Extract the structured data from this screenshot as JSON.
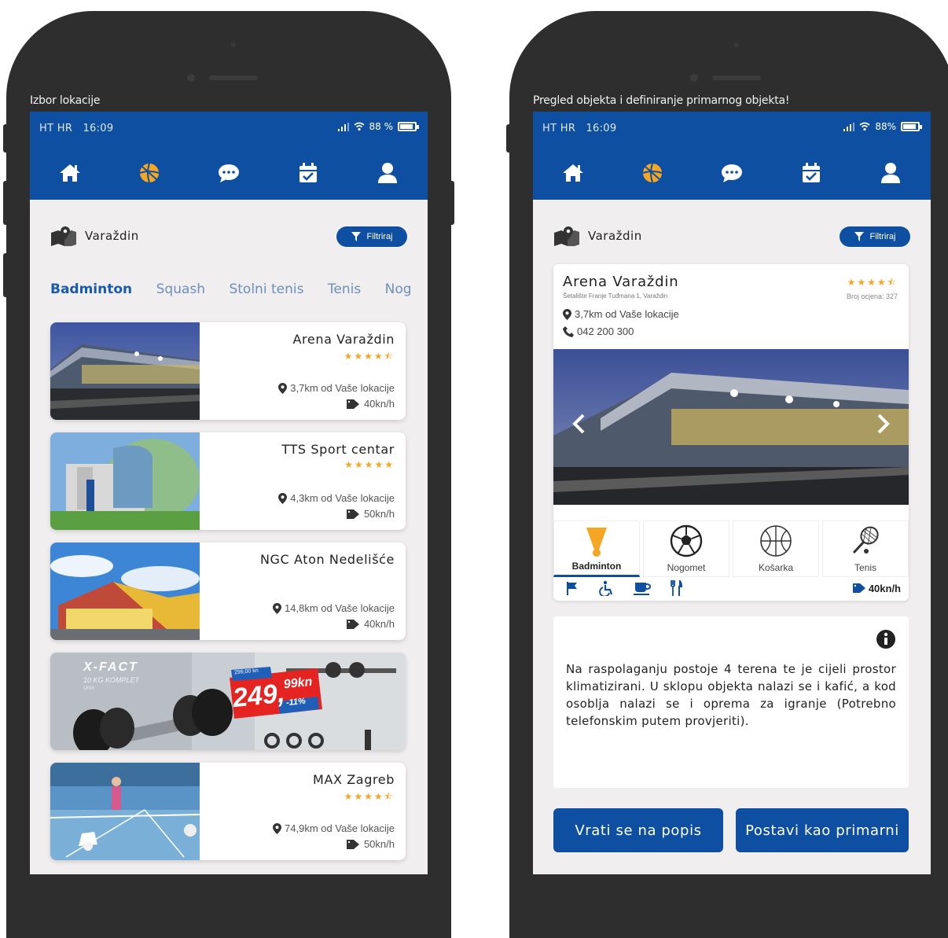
{
  "colors": {
    "brand": "#0e4fa2",
    "star": "#f5a623",
    "frame": "#2e2e2e",
    "screen_bg": "#f0eeee"
  },
  "left": {
    "caption": "Izbor lokacije",
    "status": {
      "carrier": "HT HR",
      "time": "16:09",
      "battery": "88 %",
      "battery_level": 0.88
    },
    "nav": [
      "home-icon",
      "volleyball-icon",
      "chat-icon",
      "calendar-check-icon",
      "user-icon"
    ],
    "location": "Varaždin",
    "filter_label": "Filtriraj",
    "tabs": [
      "Badminton",
      "Squash",
      "Stolni tenis",
      "Tenis",
      "Nog"
    ],
    "cards": [
      {
        "name": "Arena Varaždin",
        "stars": "★★★★⯪",
        "distance": "3,7km od Vaše lokacije",
        "price": "40kn/h"
      },
      {
        "name": "TTS Sport centar",
        "stars": "★★★★★",
        "distance": "4,3km od Vaše lokacije",
        "price": "50kn/h"
      },
      {
        "name": "NGC Aton Nedelišće",
        "stars": "",
        "distance": "14,8km od Vaše lokacije",
        "price": "40kn/h"
      },
      {
        "name": "MAX Zagreb",
        "stars": "★★★★⯪",
        "distance": "74,9km od Vaše lokacije",
        "price": "50kn/h"
      }
    ],
    "ad": {
      "brand": "X-FACT",
      "subtitle": "10 KG KOMPLET",
      "sub2": "Unix",
      "old_price": "299,00 kn",
      "price_main": "249,",
      "price_dec": "99kn",
      "discount": "-11%"
    }
  },
  "right": {
    "caption": "Pregled objekta i definiranje primarnog objekta!",
    "status": {
      "carrier": "HT HR",
      "time": "16:09",
      "battery": "88%",
      "battery_level": 0.88
    },
    "location": "Varaždin",
    "filter_label": "Filtriraj",
    "venue": {
      "name": "Arena Varaždin",
      "address": "Šetalište Franje Tuđmana 1, Varaždin",
      "stars": "★★★★⯪",
      "ratings": "Broj ocjena: 327",
      "distance": "3,7km od Vaše lokacije",
      "phone": "042 200 300"
    },
    "sports": [
      "Badminton",
      "Nogomet",
      "Košarka",
      "Tenis"
    ],
    "amenities": [
      "flag-icon",
      "wheelchair-icon",
      "coffee-icon",
      "restaurant-icon"
    ],
    "price": "40kn/h",
    "description": "Na raspolaganju postoje 4 terena te je cijeli prostor klimatizirani. U sklopu objekta nalazi se i kafić, a kod osoblja nalazi se i oprema za igranje (Potrebno telefonskim putem provjeriti).",
    "buttons": {
      "back": "Vrati se na popis",
      "primary": "Postavi kao primarni"
    }
  }
}
